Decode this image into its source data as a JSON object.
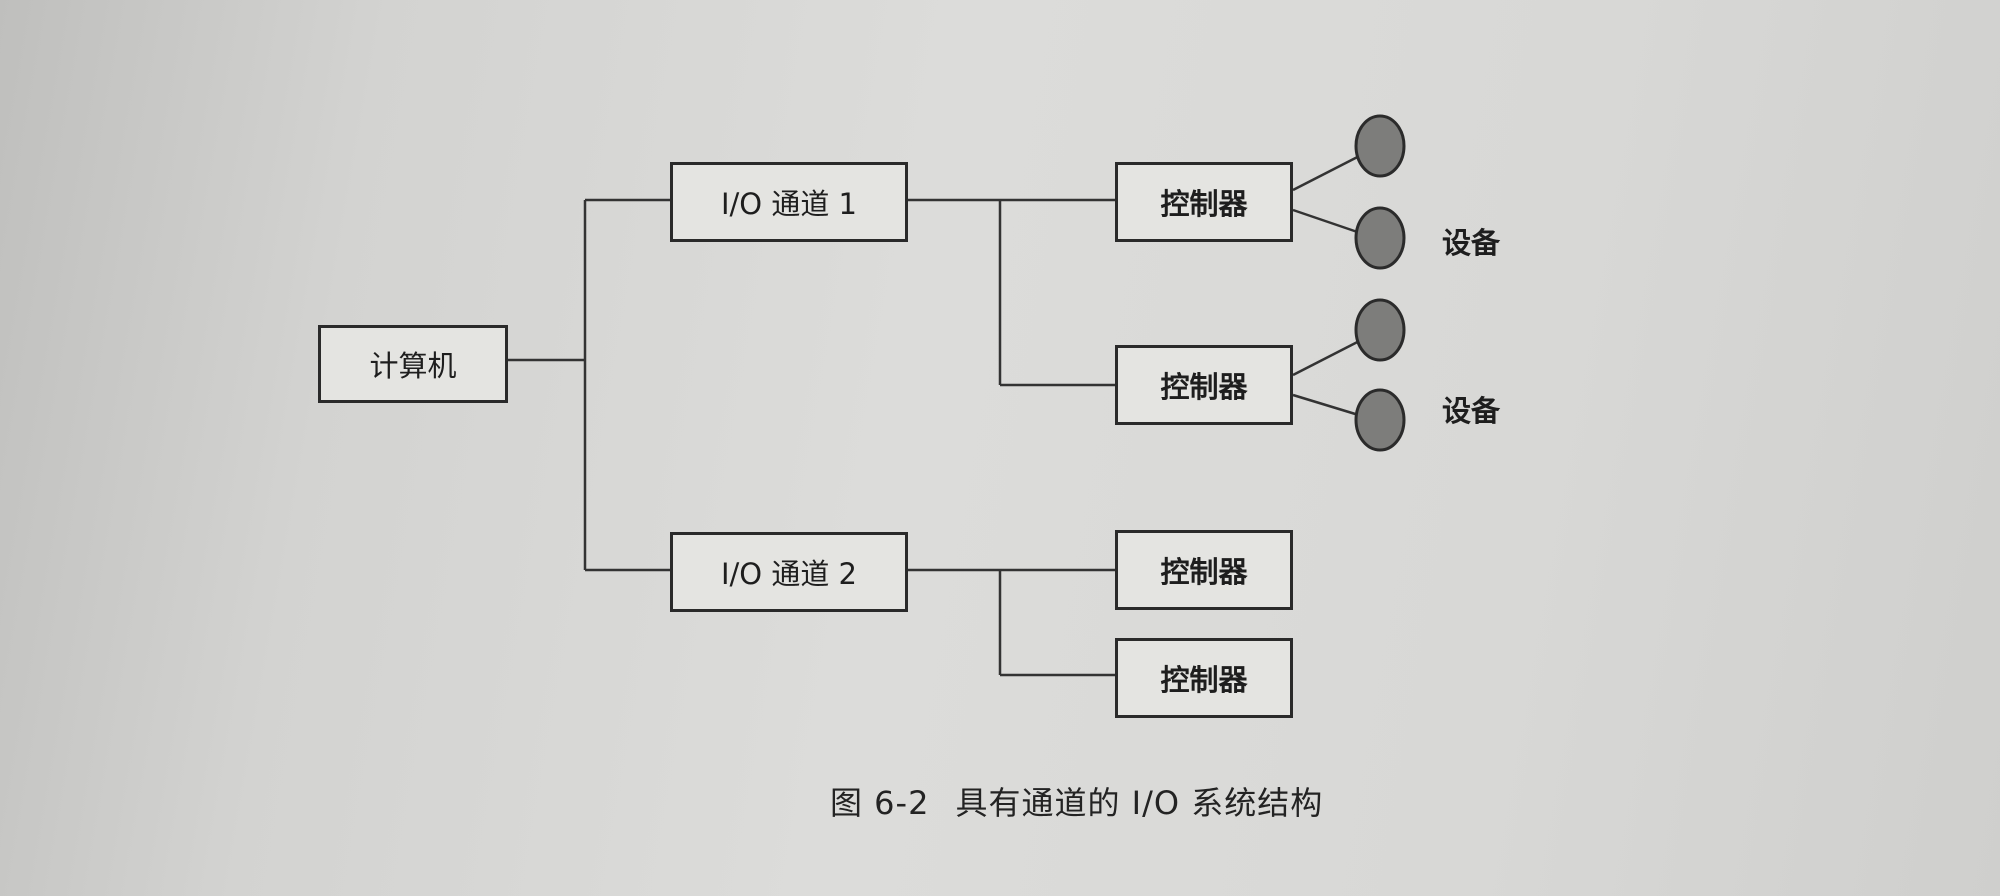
{
  "diagram": {
    "computer": "计算机",
    "channels": [
      "I/O 通道 1",
      "I/O 通道 2"
    ],
    "controllers": [
      "控制器",
      "控制器",
      "控制器",
      "控制器"
    ],
    "device_labels": [
      "设备",
      "设备"
    ]
  },
  "caption": {
    "number": "图 6-2",
    "title": "具有通道的 I/O 系统结构"
  }
}
